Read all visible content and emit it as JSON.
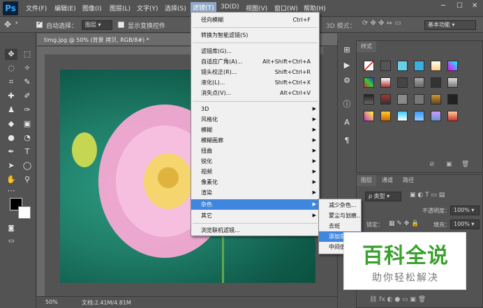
{
  "menubar": {
    "logo": "Ps",
    "items": [
      "文件(F)",
      "编辑(E)",
      "图像(I)",
      "图层(L)",
      "文字(Y)",
      "选择(S)",
      "滤镜(T)",
      "3D(D)",
      "视图(V)",
      "窗口(W)",
      "帮助(H)"
    ],
    "active_item": "滤镜(T)"
  },
  "options": {
    "auto_select_label": "自动选择：",
    "auto_select_value": "图层",
    "show_transform_label": "显示变换控件",
    "mode_3d_label": "3D 模式：",
    "workspace_value": "基本功能"
  },
  "document": {
    "tab_title": "timg.jpg @ 50% (背景 拷贝, RGB/8#) *",
    "zoom": "50%",
    "doc_info": "文档:2.41M/4.81M"
  },
  "filter_menu": {
    "items": [
      {
        "label": "径向模糊",
        "shortcut": "Ctrl+F"
      },
      {
        "label": "转换为智能滤镜(S)"
      },
      {
        "label": "滤镜库(G)..."
      },
      {
        "label": "自适应广角(A)...",
        "shortcut": "Alt+Shift+Ctrl+A"
      },
      {
        "label": "镜头校正(R)...",
        "shortcut": "Shift+Ctrl+R"
      },
      {
        "label": "液化(L)...",
        "shortcut": "Shift+Ctrl+X"
      },
      {
        "label": "消失点(V)...",
        "shortcut": "Alt+Ctrl+V"
      },
      {
        "label": "3D"
      },
      {
        "label": "风格化"
      },
      {
        "label": "模糊"
      },
      {
        "label": "模糊画廊"
      },
      {
        "label": "扭曲"
      },
      {
        "label": "锐化"
      },
      {
        "label": "视频"
      },
      {
        "label": "像素化"
      },
      {
        "label": "渲染"
      },
      {
        "label": "杂色"
      },
      {
        "label": "其它"
      },
      {
        "label": "浏览联机滤镜..."
      }
    ],
    "highlighted": "杂色"
  },
  "noise_submenu": {
    "items": [
      "减少杂色...",
      "蒙尘与划痕...",
      "去斑",
      "添加杂色...",
      "中间值..."
    ],
    "highlighted": "添加杂色..."
  },
  "styles_panel": {
    "title": "样式"
  },
  "layers_panel": {
    "tabs": [
      "图层",
      "通道",
      "路径"
    ],
    "kind_label": "ρ 类型",
    "opacity_label": "不透明度：",
    "opacity_value": "100%",
    "lock_label": "锁定：",
    "fill_label": "填充：",
    "fill_value": "100%"
  },
  "watermark": {
    "title": "百科全说",
    "subtitle": "助你轻松解决"
  },
  "colors": {
    "menu_highlight": "#3f86de",
    "ui_bg": "#535353",
    "watermark_green": "#3aa12d"
  }
}
